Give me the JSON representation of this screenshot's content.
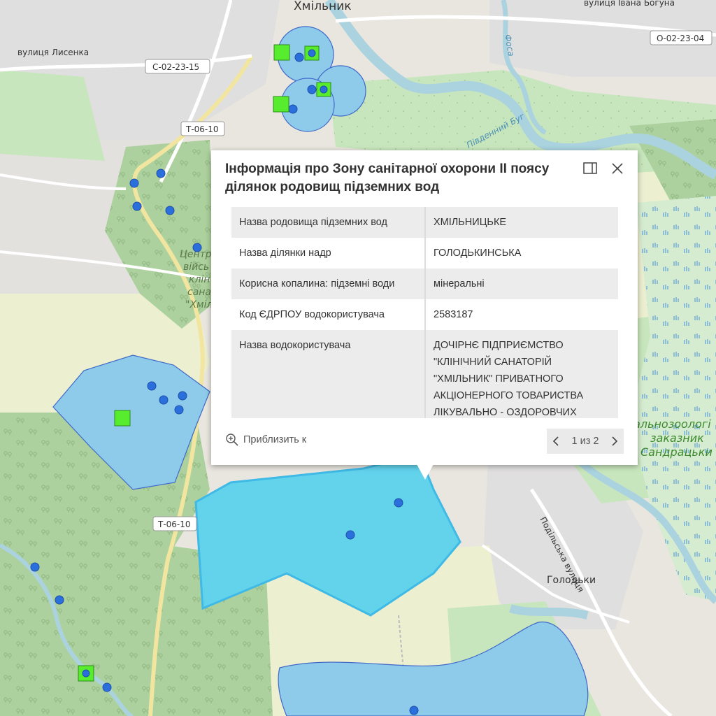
{
  "map": {
    "city_label": "Хмільник",
    "village_label": "Голодьки",
    "street_labels": {
      "lysenka": "вулиця Лисенка",
      "bohuna": "вулиця Івана Богуна",
      "podilska": "Подільська вулиця"
    },
    "road_badges": {
      "s_02_23_15": "С-02-23-15",
      "o_02_23_04": "О-02-23-04",
      "t_06_10_top": "Т-06-10",
      "t_06_10_bottom": "Т-06-10"
    },
    "river_labels": {
      "pivdennyi_buh": "Південний Буг",
      "fosa": "Фоса"
    },
    "sanatorium_label_lines": [
      "Центр",
      "війсь",
      "клін",
      "сана",
      "\"Хміл"
    ],
    "reserve_label_lines": [
      "альнозоологі",
      "заказник",
      "Сандрацьки"
    ],
    "colors": {
      "zone_fill": "#8ecbea",
      "zone_selected_fill": "#63d3ec",
      "zone_stroke": "#3f68c9",
      "well_point": "#2a6fdb",
      "square_marker": "#58ec2e",
      "forest": "#add19e",
      "farmland": "#ecefd0",
      "water": "#aad3df",
      "urban": "#e0dfdf",
      "background": "#e9e6df"
    }
  },
  "popup": {
    "title": "Інформація про Зону санітарної охорони ІІ поясу ділянок родовищ підземних вод",
    "dock_icon": "dock-icon",
    "close_icon": "close-icon",
    "rows": [
      {
        "key": "Назва родовища підземних вод",
        "value": "ХМІЛЬНИЦЬКЕ"
      },
      {
        "key": "Назва ділянки надр",
        "value": "ГОЛОДЬКИНСЬКА"
      },
      {
        "key": "Корисна копалина: підземні води",
        "value": "мінеральні"
      },
      {
        "key": "Код ЄДРПОУ водокористувача",
        "value": "2583187"
      },
      {
        "key": "Назва водокористувача",
        "value": "ДОЧІРНЄ ПІДПРИЄМСТВО \"КЛІНІЧНИЙ САНАТОРІЙ \"ХМІЛЬНИК\" ПРИВАТНОГО АКЦІОНЕРНОГО ТОВАРИСТВА ЛІКУВАЛЬНО - ОЗДОРОВЧИХ"
      }
    ],
    "zoom_to_label": "Приблизить к",
    "pager_label": "1 из 2"
  }
}
